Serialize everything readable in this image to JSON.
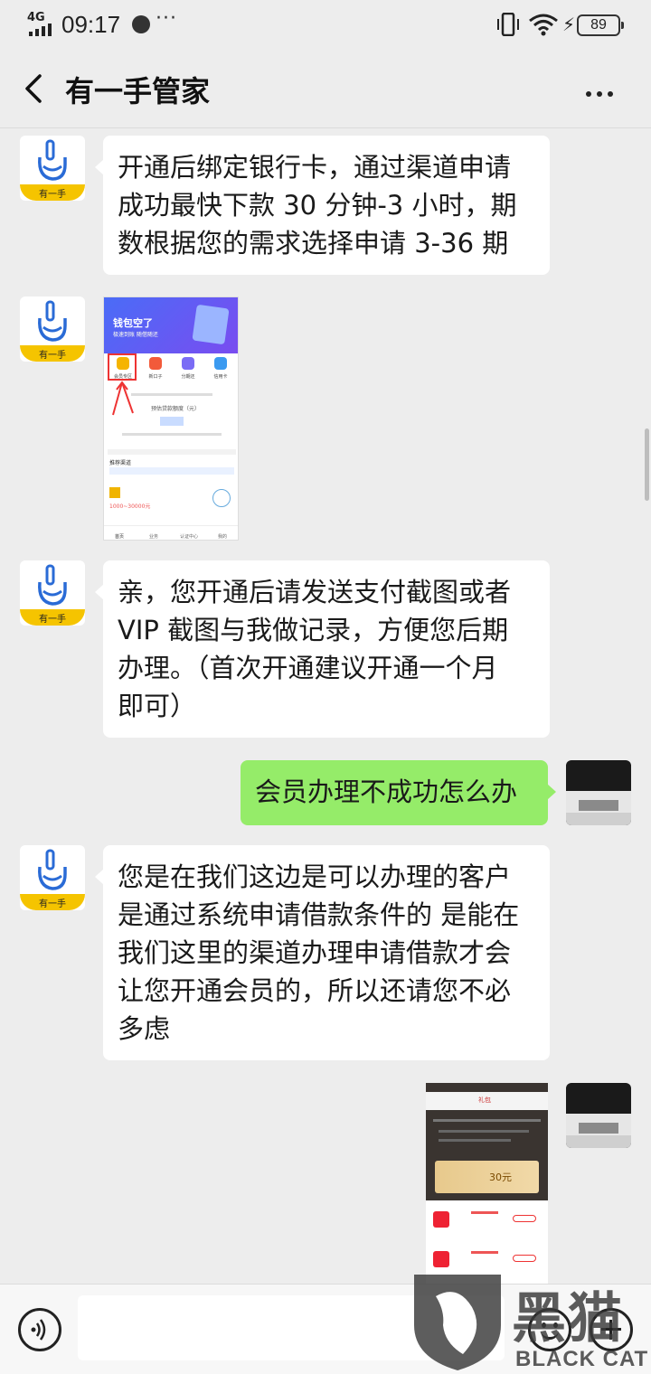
{
  "status_bar": {
    "network": "4G",
    "time": "09:17",
    "more": "···",
    "battery": "89"
  },
  "header": {
    "title": "有一手管家"
  },
  "bot": {
    "avatar_label": "有一手"
  },
  "messages": [
    {
      "side": "left",
      "type": "text",
      "text": "开通后绑定银行卡，通过渠道申请\n成功最快下款 30 分钟-3 小时，期\n数根据您的需求选择申请 3-36 期"
    },
    {
      "side": "left",
      "type": "image",
      "content": {
        "banner_title": "钱包空了",
        "banner_sub": "极速到账 随借随还",
        "icons": [
          "会员专区",
          "新口子",
          "分期还",
          "信用卡"
        ],
        "amount_label": "预估贷款额度（元）",
        "section": "推荐渠道",
        "range": "1000~30000元",
        "tabs": [
          "首页",
          "业务",
          "认证中心",
          "我的"
        ]
      }
    },
    {
      "side": "left",
      "type": "text",
      "text": "亲，您开通后请发送支付截图或者\nVIP 截图与我做记录，方便您后期\n办理。（首次开通建议开通一个月\n即可）"
    },
    {
      "side": "right",
      "type": "text",
      "text": "会员办理不成功怎么办"
    },
    {
      "side": "left",
      "type": "text",
      "text": "您是在我们这边是可以办理的客户\n是通过系统申请借款条件的 是能在\n我们这里的渠道办理申请借款才会\n让您开通会员的，所以还请您不必\n多虑"
    },
    {
      "side": "right",
      "type": "image",
      "content": {
        "header": "礼包",
        "price": "30元"
      }
    }
  ],
  "input_bar": {
    "placeholder": ""
  },
  "watermark": {
    "cn": "黑猫",
    "en": "BLACK CAT"
  }
}
